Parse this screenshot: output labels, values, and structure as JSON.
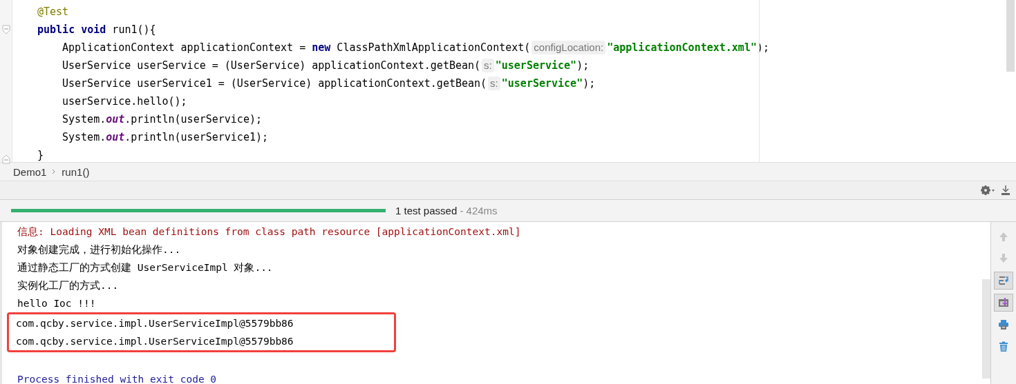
{
  "editor": {
    "lines": [
      {
        "kind": "annotation",
        "tokens": [
          {
            "kind": "annotation",
            "text": "@Test"
          }
        ]
      },
      {
        "kind": "signature",
        "tokens": [
          {
            "kind": "keyword",
            "text": "public void"
          },
          {
            "kind": "plain",
            "text": " run1(){"
          }
        ]
      },
      {
        "kind": "body",
        "tokens": [
          {
            "kind": "plain",
            "text": "ApplicationContext applicationContext = "
          },
          {
            "kind": "keyword",
            "text": "new"
          },
          {
            "kind": "plain",
            "text": " ClassPathXmlApplicationContext("
          },
          {
            "kind": "hint",
            "text": "configLocation:"
          },
          {
            "kind": "string",
            "text": "\"applicationContext.xml\""
          },
          {
            "kind": "plain",
            "text": ");"
          }
        ]
      },
      {
        "kind": "body",
        "tokens": [
          {
            "kind": "plain",
            "text": "UserService userService = (UserService) applicationContext.getBean("
          },
          {
            "kind": "hint",
            "text": "s:"
          },
          {
            "kind": "string",
            "text": "\"userService\""
          },
          {
            "kind": "plain",
            "text": ");"
          }
        ]
      },
      {
        "kind": "body",
        "tokens": [
          {
            "kind": "plain",
            "text": "UserService userService1 = (UserService) applicationContext.getBean("
          },
          {
            "kind": "hint",
            "text": "s:"
          },
          {
            "kind": "string",
            "text": "\"userService\""
          },
          {
            "kind": "plain",
            "text": ");"
          }
        ]
      },
      {
        "kind": "body",
        "tokens": [
          {
            "kind": "plain",
            "text": "userService.hello();"
          }
        ]
      },
      {
        "kind": "body",
        "tokens": [
          {
            "kind": "plain",
            "text": "System."
          },
          {
            "kind": "static",
            "text": "out"
          },
          {
            "kind": "plain",
            "text": ".println(userService);"
          }
        ]
      },
      {
        "kind": "body",
        "tokens": [
          {
            "kind": "plain",
            "text": "System."
          },
          {
            "kind": "static",
            "text": "out"
          },
          {
            "kind": "plain",
            "text": ".println(userService1);"
          }
        ]
      },
      {
        "kind": "close",
        "tokens": [
          {
            "kind": "plain",
            "text": "}"
          }
        ]
      }
    ]
  },
  "breadcrumbs": [
    "Demo1",
    "run1()"
  ],
  "test_status": {
    "level": 1,
    "result": "1 test passed",
    "duration": " - 424ms"
  },
  "console": {
    "lines": [
      {
        "kind": "info",
        "highlighted": false,
        "text": "信息: Loading XML bean definitions from class path resource [applicationContext.xml]"
      },
      {
        "kind": "output",
        "highlighted": false,
        "text": "对象创建完成，进行初始化操作..."
      },
      {
        "kind": "output",
        "highlighted": false,
        "text": "通过静态工厂的方式创建 UserServiceImpl 对象..."
      },
      {
        "kind": "output",
        "highlighted": false,
        "text": "实例化工厂的方式..."
      },
      {
        "kind": "output",
        "highlighted": false,
        "text": "hello Ioc !!!"
      },
      {
        "kind": "output",
        "highlighted": true,
        "text": "com.qcby.service.impl.UserServiceImpl@5579bb86"
      },
      {
        "kind": "output",
        "highlighted": true,
        "text": "com.qcby.service.impl.UserServiceImpl@5579bb86"
      },
      {
        "kind": "blank",
        "highlighted": false
      },
      {
        "kind": "system",
        "highlighted": false,
        "text": "Process finished with exit code 0"
      }
    ]
  },
  "side_tools": [
    {
      "kind": "up",
      "selected": false
    },
    {
      "kind": "down",
      "selected": false
    },
    {
      "kind": "wrap",
      "selected": true
    },
    {
      "kind": "scroll",
      "selected": true
    },
    {
      "kind": "print",
      "selected": false
    },
    {
      "kind": "trash",
      "selected": false
    }
  ]
}
